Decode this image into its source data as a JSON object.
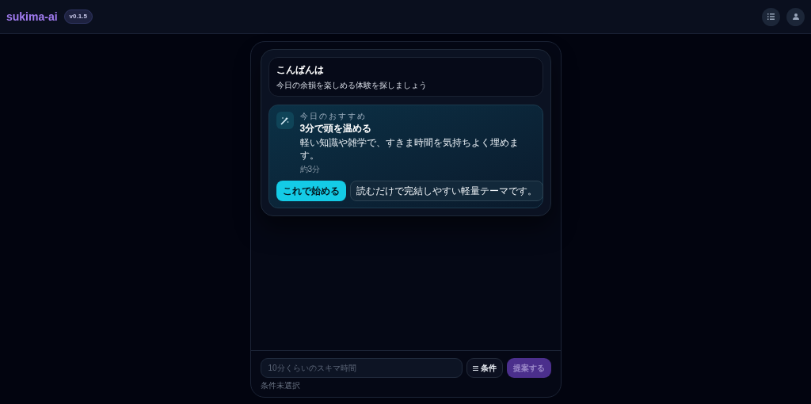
{
  "header": {
    "logo": "sukima-ai",
    "version": "v0.1.5"
  },
  "greeting": {
    "title": "こんばんは",
    "subtitle": "今日の余韻を楽しめる体験を探しましょう"
  },
  "recommendation": {
    "label": "今日のおすすめ",
    "title": "3分で頭を温める",
    "description": "軽い知識や雑学で、すきま時間を気持ちよく埋めます。",
    "duration": "約3分",
    "start_button": "これで始める",
    "note": "読むだけで完結しやすい軽量テーマです。"
  },
  "composer": {
    "placeholder": "10分くらいのスキマ時間",
    "conditions_button": "条件",
    "submit_button": {
      "label": "提案する",
      "disabled": true
    },
    "conditions_status": "条件未選択"
  }
}
